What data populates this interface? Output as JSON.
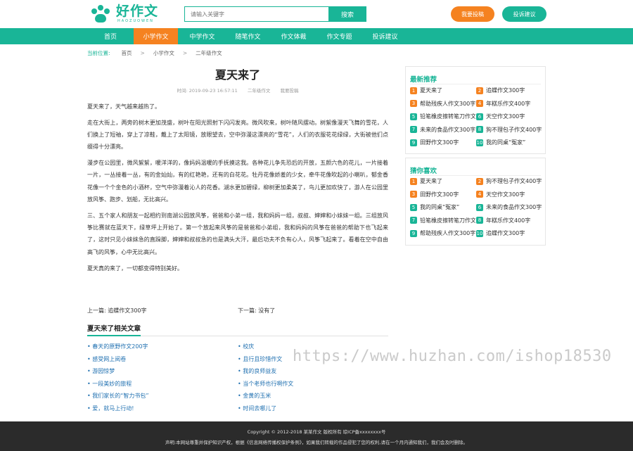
{
  "colors": {
    "accent": "#19b597",
    "orange": "#f58220",
    "link": "#1e6fb0",
    "footer_bg": "#2b2b2b"
  },
  "header": {
    "logo_title": "好作文",
    "logo_sub": "HAOZUOWEN",
    "logo_icon": "paw-icon",
    "search_placeholder": "请输入关键字",
    "search_button": "搜索",
    "submit_button": "我要投稿",
    "complaint_button": "投诉建议"
  },
  "nav": {
    "items": [
      "首页",
      "小学作文",
      "中学作文",
      "随笔作文",
      "作文体裁",
      "作文专题",
      "投诉建议"
    ],
    "active": "小学作文"
  },
  "breadcrumb": {
    "label": "当前位置:",
    "items": [
      "首页",
      "小学作文",
      "二年级作文"
    ],
    "separator": ">"
  },
  "article": {
    "title": "夏天来了",
    "time": "时间: 2019-09-23 16:57:11",
    "category": "二年级作文",
    "author": "我要投稿",
    "paragraphs": [
      "夏天来了，天气越来越热了。",
      "走在大街上，两旁的树木更加茂盛，树叶在阳光照射下闪闪发亮。微风吹来，树叶随风摆动。树絮像漫天飞舞的雪花，人们换上了短袖，穿上了凉鞋，戴上了太阳镜，放眼望去，空中弥漫这漂亮的“雪花”，人们的衣服花花绿绿，大街被他们点缀得十分漂亮。",
      "漫步在公园里，微风絮絮，暖洋洋的，像妈妈温暖的手抚摸这我。各种花儿争先恐后的开放，五颜六色的花儿，一片接着一片，一丛接着一丛，有的金灿灿，有的红艳艳，还有的白花花。牡丹花像娇羞的少女，牵牛花像吹起的小喇叭，郁金香花像一个个金色的小酒杯，空气中弥漫着沁人的花香。湖水更加碧绿，柳树更加柔美了，鸟儿更加欢快了，游人在公园里放风筝、跑步、划船，无比高兴。",
      "三、五个家人和朋友一起相约到南湖公园放风筝，爸爸和小弟一组，我和妈妈一组，叔叔、婶婶和小妹妹一组。三组放风筝比赛就在蓝天下，绿草坪上开始了。第一个放起来风筝的是爸爸和小弟组，我和妈妈的风筝在爸爸的帮助下也飞起来了，这时只见小妹妹急的直跺脚，婶婶和叔叔急的也是满头大汗，最后功夫不负有心人，风筝飞起来了。看着在空中自由高飞的风筝，心中无比高兴。",
      "夏天真的来了，一切都变得特别美好。"
    ],
    "prev_label": "上一篇: ",
    "prev_title": "追蝶作文300字",
    "next_label": "下一篇: ",
    "next_title": "没有了"
  },
  "related": {
    "title": "夏天来了相关文章",
    "left": [
      "春天的原野作文200字",
      "感受网上阅卷",
      "游园惊梦",
      "一段美妙的旅程",
      "我们家长的“智力书包”",
      "爱，就马上行动!"
    ],
    "right": [
      "校庆",
      "且行且珍惜作文",
      "我的良师益友",
      "当个老师也行啊作文",
      "金黄的玉米",
      "时间去哪儿了"
    ]
  },
  "sidebar": {
    "latest_title": "最新推荐",
    "latest": [
      "夏天来了",
      "追蝶作文300字",
      "帮助残疾人作文300字",
      "年糕乐作文400字",
      "铅笔橡皮擦转笔刀作文",
      "天空作文300字",
      "未来的食品作文300字",
      "狗不理包子作文400字",
      "田野作文300字",
      "我的同桌“冤家”"
    ],
    "guess_title": "猜你喜欢",
    "guess": [
      "夏天来了",
      "狗不理包子作文400字",
      "田野作文300字",
      "天空作文300字",
      "我的同桌“冤家”",
      "未来的食品作文300字",
      "铅笔橡皮擦转笔刀作文",
      "年糕乐作文400字",
      "帮助残疾人作文300字",
      "追蝶作文300字"
    ]
  },
  "watermark": "https://www.huzhan.com/ishop18530",
  "footer": {
    "line1": "Copyright © 2012-2018 某某作文 版权所有 琼ICP备xxxxxxxx号",
    "line2": "声明:本网站尊重并保护知识产权，根据《信息网络传播权保护条例》，如果我们转载的作品侵犯了您的权利,请在一个月内通知我们，我们会及时删除。"
  }
}
